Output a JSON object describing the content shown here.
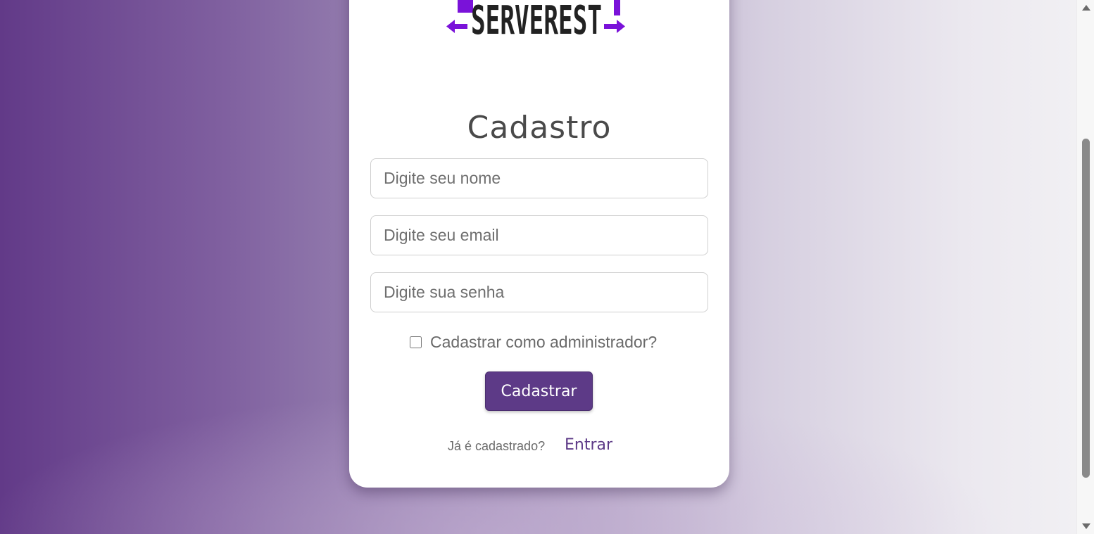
{
  "logo": {
    "text": "SERVEREST",
    "accent_color": "#7a12d9",
    "text_color": "#222222"
  },
  "form": {
    "title": "Cadastro",
    "name_placeholder": "Digite seu nome",
    "email_placeholder": "Digite seu email",
    "password_placeholder": "Digite sua senha",
    "admin_label": "Cadastrar como administrador?",
    "admin_checked": false,
    "submit_label": "Cadastrar",
    "already_registered_text": "Já é cadastrado?",
    "login_link_label": "Entrar"
  },
  "colors": {
    "primary": "#5d3a87",
    "background_start": "#623a88",
    "background_end": "#f2f1f4"
  }
}
